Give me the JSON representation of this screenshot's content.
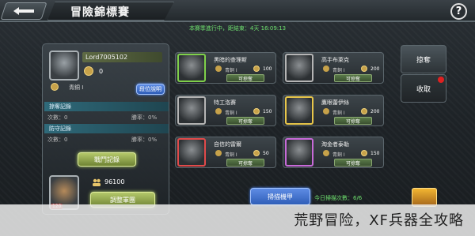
{
  "header": {
    "title": "冒險錦標賽",
    "help_label": "?"
  },
  "season_notice": "本賽季進行中，距結束：4天 16:09:13",
  "player": {
    "name": "Lord7005102",
    "level_value": "0",
    "rank": "青銅 I",
    "rank_button": "段位說明"
  },
  "sections": {
    "plunder_record": "掠奪記錄",
    "plunder_count": "次數：0",
    "plunder_rate": "勝率：0%",
    "defense_record": "防守記錄",
    "defense_count": "次數：0",
    "defense_rate": "勝率：0%"
  },
  "battle_log_button": "戰鬥記錄",
  "power_value": "96100",
  "mech_level": "120",
  "adjust_button": "調整軍團",
  "opponents": [
    {
      "name": "黑暗的查理斯",
      "rank": "青銅 I",
      "reward": "100",
      "action": "可掠奪",
      "border": "#7fd04a"
    },
    {
      "name": "高手布萊克",
      "rank": "青銅 I",
      "reward": "200",
      "action": "可掠奪",
      "border": "#b5b5b5"
    },
    {
      "name": "特工洛賽",
      "rank": "青銅 I",
      "reward": "150",
      "action": "可掠奪",
      "border": "#b5b5b5"
    },
    {
      "name": "鷹眼蕾伊絲",
      "rank": "青銅 I",
      "reward": "200",
      "action": "可掠奪",
      "border": "#e8c64a"
    },
    {
      "name": "自信的雷爾",
      "rank": "青銅 I",
      "reward": "50",
      "action": "可掠奪",
      "border": "#e04a4a"
    },
    {
      "name": "淘金者泰勒",
      "rank": "青銅 I",
      "reward": "150",
      "action": "可掠奪",
      "border": "#c76ad8"
    }
  ],
  "scan_button": "掃描機甲",
  "scan_today": "今日掃描次數：6/6",
  "tabs": {
    "plunder": "掠奪",
    "collect": "收取"
  },
  "watermark": "荒野冒险，XF兵器全攻略"
}
